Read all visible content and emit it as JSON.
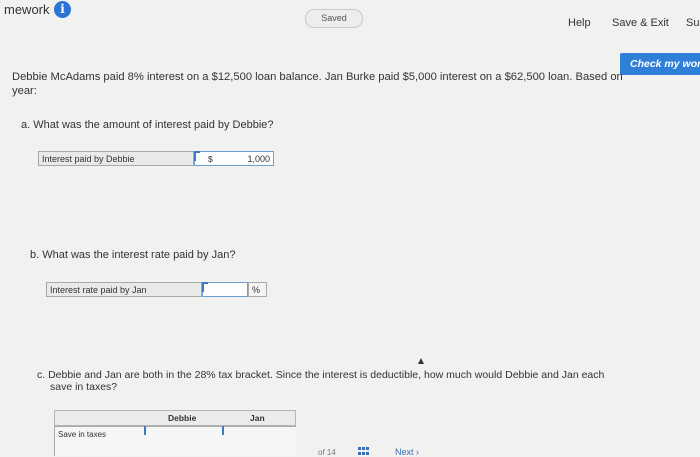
{
  "header": {
    "title": "mework",
    "saved": "Saved",
    "help": "Help",
    "save_exit": "Save & Exit",
    "submit": "Su",
    "check_work": "Check my wor"
  },
  "problem": {
    "prompt": "Debbie McAdams paid 8% interest on a $12,500 loan balance. Jan Burke paid $5,000 interest on a $62,500 loan. Based on",
    "prompt_line2": "year:"
  },
  "part_a": {
    "question": "a. What was the amount of interest paid by Debbie?",
    "label": "Interest paid by Debbie",
    "unit": "$",
    "value": "1,000"
  },
  "part_b": {
    "question": "b. What was the interest rate paid by Jan?",
    "label": "Interest rate paid by Jan",
    "value": "",
    "unit": "%"
  },
  "part_c": {
    "question_line1": "c. Debbie and Jan are both in the 28% tax bracket. Since the interest is deductible, how much would Debbie and Jan each",
    "question_line2": "save in taxes?",
    "col_debbie": "Debbie",
    "col_jan": "Jan",
    "row_label": "Save in taxes"
  },
  "pagination": {
    "of_total": "of 14",
    "next": "Next"
  },
  "colors": {
    "accent": "#2f7fd8",
    "page_bg": "#f1f1ef"
  }
}
